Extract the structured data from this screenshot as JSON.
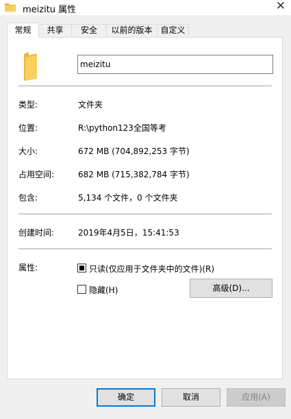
{
  "window": {
    "title": "meizitu 属性",
    "close_glyph": "✕"
  },
  "tabs": [
    {
      "label": "常规",
      "active": true
    },
    {
      "label": "共享",
      "active": false
    },
    {
      "label": "安全",
      "active": false
    },
    {
      "label": "以前的版本",
      "active": false
    },
    {
      "label": "自定义",
      "active": false
    }
  ],
  "general": {
    "folder_name": "meizitu",
    "type_label": "类型:",
    "type_value": "文件夹",
    "location_label": "位置:",
    "location_value": "R:\\python123全国等考",
    "size_label": "大小:",
    "size_value": "672 MB (704,892,253 字节)",
    "size_on_disk_label": "占用空间:",
    "size_on_disk_value": "682 MB (715,382,784 字节)",
    "contains_label": "包含:",
    "contains_value": "5,134 个文件，0 个文件夹",
    "created_label": "创建时间:",
    "created_value": "2019年4月5日，15:41:53",
    "attributes_label": "属性:",
    "readonly_label": "只读(仅应用于文件夹中的文件)(R)",
    "readonly_state": "indeterminate",
    "hidden_label": "隐藏(H)",
    "hidden_state": "unchecked",
    "advanced_label": "高级(D)..."
  },
  "footer": {
    "ok_label": "确定",
    "cancel_label": "取消",
    "apply_label": "应用(A)"
  },
  "colors": {
    "folder": "#f7cf5d",
    "folder_dark": "#e8b53f",
    "accent": "#0078d7"
  }
}
